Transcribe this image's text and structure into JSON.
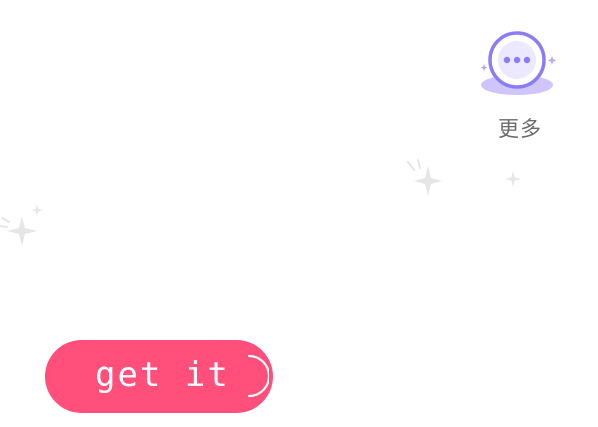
{
  "more": {
    "label": "更多",
    "icon": "more-dots-icon"
  },
  "cta": {
    "label": "get it",
    "icon": "loading-arc-icon"
  },
  "colors": {
    "accent_pink": "#ff4f7a",
    "icon_purple": "#8b7cf6",
    "icon_fill": "#ece8ff",
    "icon_shadow": "#cfc5fb",
    "label_gray": "#6b6b6b",
    "sparkle_gray": "#e4e4e4"
  }
}
